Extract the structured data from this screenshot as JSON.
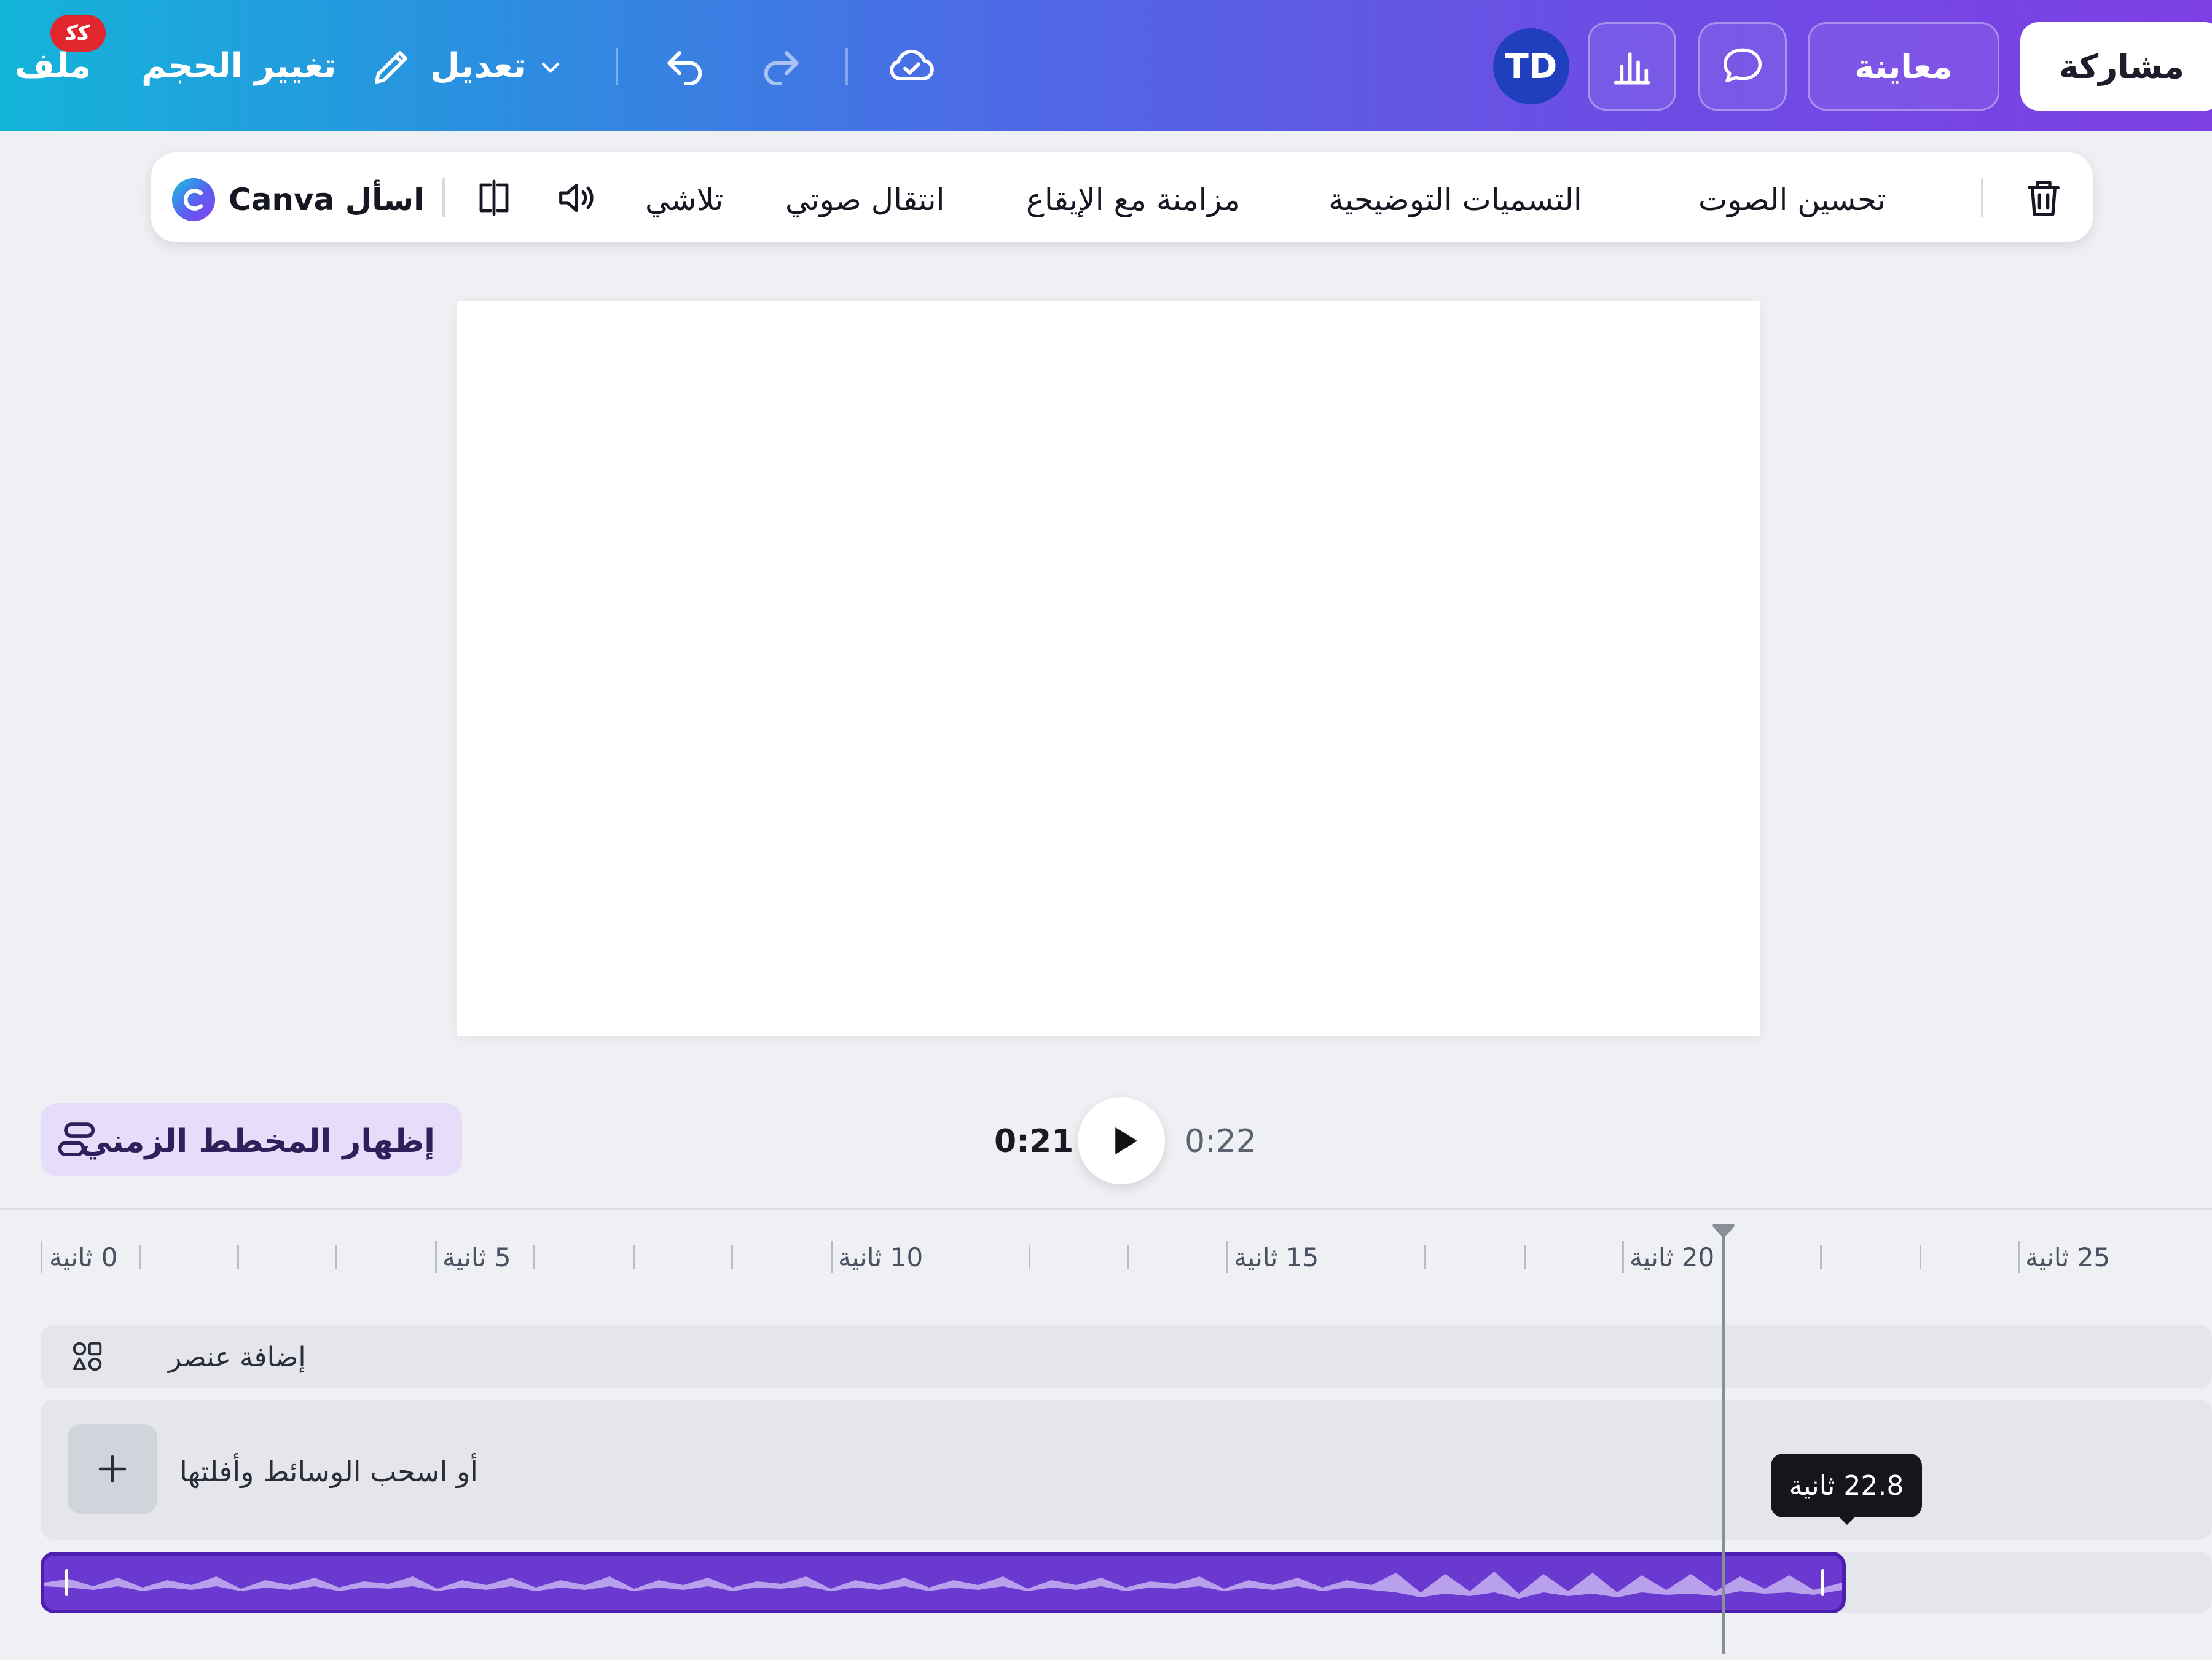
{
  "header": {
    "file_label": "ملف",
    "file_badge": "ﮐﮐ",
    "resize_label": "تغيير الحجم",
    "edit_label": "تعديل",
    "preview_label": "معاينة",
    "share_label": "مشاركة",
    "avatar_initials": "TD"
  },
  "context_toolbar": {
    "ask_canva": "اسأل Canva",
    "fade": "تلاشي",
    "audio_transition": "انتقال صوتي",
    "beat_sync": "مزامنة مع الإيقاع",
    "captions": "التسميات التوضيحية",
    "enhance_audio": "تحسين الصوت"
  },
  "playback": {
    "show_timeline": "إظهار المخطط الزمني",
    "current_time": "0:21",
    "total_time": "0:22"
  },
  "ruler": {
    "labels": [
      "0 ثانية",
      "5 ثانية",
      "10 ثانية",
      "15 ثانية",
      "20 ثانية",
      "25 ثانية"
    ]
  },
  "tracks": {
    "add_element": "إضافة عنصر",
    "drag_media": "أو اسحب الوسائط وأفلتها",
    "audio_duration_tooltip": "22.8 ثانية"
  },
  "colors": {
    "accent": "#7d3fe4",
    "audio_clip": "#6a3ad0",
    "timeline_button_bg": "#e6ddfb"
  }
}
